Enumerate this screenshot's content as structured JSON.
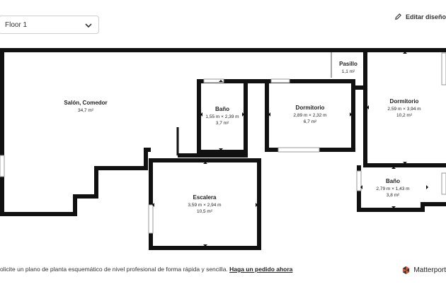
{
  "floor_selector": {
    "value": "Floor 1"
  },
  "edit_link": {
    "label": "Editar diseño"
  },
  "rooms": {
    "salon": {
      "name": "Salón, Comedor",
      "dims": "",
      "area": "34,7 m²"
    },
    "pasillo": {
      "name": "Pasillo",
      "dims": "",
      "area": "1,1 m²"
    },
    "bano1": {
      "name": "Baño",
      "dims": "1,55 m × 2,39 m",
      "area": "3,7 m²"
    },
    "dormitorio1": {
      "name": "Dormitorio",
      "dims": "2,89 m × 2,32 m",
      "area": "6,7 m²"
    },
    "dormitorio2": {
      "name": "Dormitorio",
      "dims": "2,59 m × 3,94 m",
      "area": "10,2 m²"
    },
    "bano2": {
      "name": "Baño",
      "dims": "2,79 m × 1,43 m",
      "area": "3,8 m²"
    },
    "escalera": {
      "name": "Escalera",
      "dims": "3,59 m × 2,94 m",
      "area": "10,5 m²"
    }
  },
  "footer": {
    "text": "olicite un plano de planta esquemático de nivel profesional de forma rápida y sencilla.",
    "link": "Haga un pedido ahora"
  },
  "brand": {
    "name": "Matterport"
  }
}
